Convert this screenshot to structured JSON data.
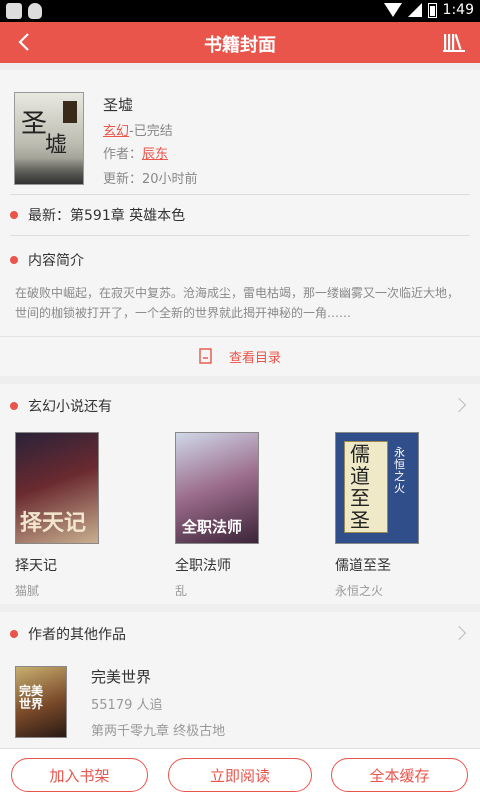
{
  "status": {
    "time": "1:49"
  },
  "header": {
    "title": "书籍封面"
  },
  "book": {
    "title": "圣墟",
    "genre": "玄幻",
    "status_text": "-已完结",
    "author_label": "作者：",
    "author": "辰东",
    "updated": "更新：20小时前",
    "latest": "最新：第591章 英雄本色"
  },
  "intro": {
    "heading": "内容简介",
    "text": "在破败中崛起，在寂灭中复苏。沧海成尘，雷电枯竭，那一缕幽雾又一次临近大地，世间的枷锁被打开了，一个全新的世界就此揭开神秘的一角……",
    "toc_label": "查看目录"
  },
  "related": {
    "heading": "玄幻小说还有",
    "books": [
      {
        "title": "择天记",
        "author": "猫腻"
      },
      {
        "title": "全职法师",
        "author": "乱"
      },
      {
        "title": "儒道至圣",
        "author": "永恒之火"
      }
    ]
  },
  "others": {
    "heading": "作者的其他作品",
    "book": {
      "title": "完美世界",
      "followers": "55179 人追",
      "latest": "第两千零九章 终极古地"
    }
  },
  "actions": {
    "add": "加入书架",
    "read": "立即阅读",
    "cache": "全本缓存"
  },
  "colors": {
    "accent": "#e9544b"
  }
}
